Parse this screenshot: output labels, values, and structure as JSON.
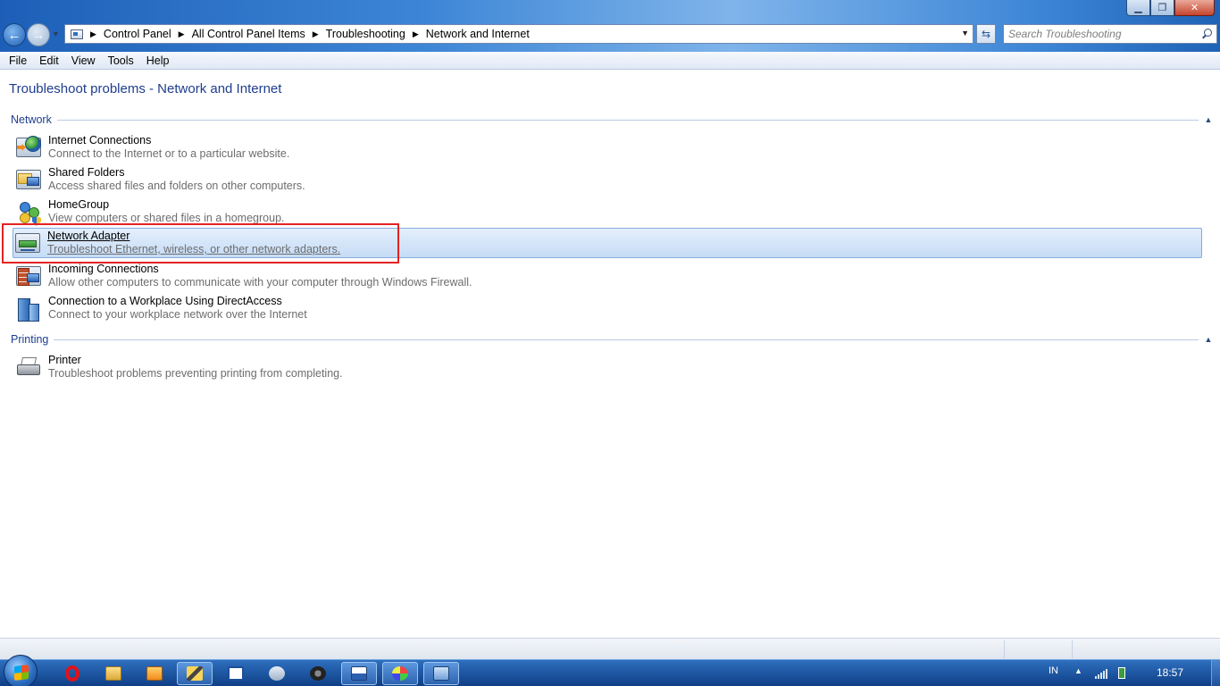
{
  "window": {
    "min_icon": "minimize-icon",
    "max_icon": "maximize-icon",
    "close_icon": "close-icon"
  },
  "nav": {
    "back_glyph": "←",
    "forward_glyph": "→",
    "dropdown_glyph": "▼"
  },
  "address": {
    "breadcrumbs": [
      "Control Panel",
      "All Control Panel Items",
      "Troubleshooting",
      "Network and Internet"
    ],
    "separator": "▶",
    "dropdown_glyph": "▼",
    "refresh_glyph": "⇆"
  },
  "search": {
    "placeholder": "Search Troubleshooting"
  },
  "menu": [
    "File",
    "Edit",
    "View",
    "Tools",
    "Help"
  ],
  "page": {
    "title": "Troubleshoot problems - Network and Internet"
  },
  "groups": [
    {
      "label": "Network",
      "collapse_glyph": "▲",
      "items": [
        {
          "name": "Internet Connections",
          "desc": "Connect to the Internet or to a particular website."
        },
        {
          "name": "Shared Folders",
          "desc": "Access shared files and folders on other computers."
        },
        {
          "name": "HomeGroup",
          "desc": "View computers or shared files in a homegroup."
        },
        {
          "name": "Network Adapter",
          "desc": "Troubleshoot Ethernet, wireless, or other network adapters."
        },
        {
          "name": "Incoming Connections",
          "desc": "Allow other computers to communicate with your computer through Windows Firewall."
        },
        {
          "name": "Connection to a Workplace Using DirectAccess",
          "desc": "Connect to your workplace network over the Internet"
        }
      ]
    },
    {
      "label": "Printing",
      "collapse_glyph": "▲",
      "items": [
        {
          "name": "Printer",
          "desc": "Troubleshoot problems preventing printing from completing."
        }
      ]
    }
  ],
  "taskbar": {
    "language": "IN",
    "tray_up_glyph": "▲",
    "clock": "18:57"
  },
  "colors": {
    "accent": "#1e3d8f",
    "highlight_border": "#e32323",
    "selection": "#c6dcf6"
  }
}
